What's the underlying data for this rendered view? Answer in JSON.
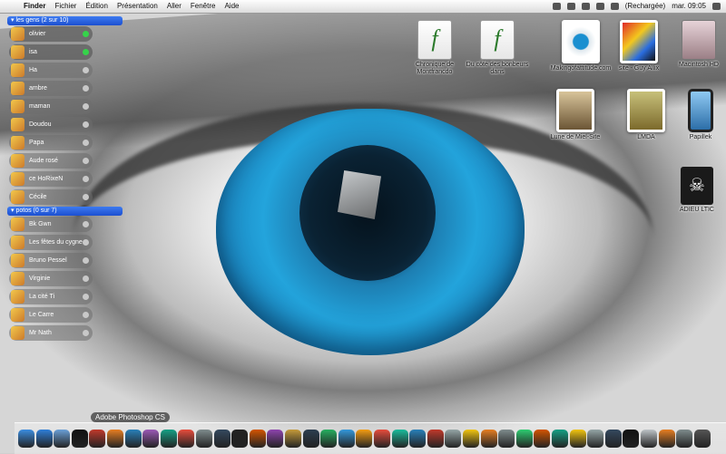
{
  "menubar": {
    "apple_glyph": "",
    "menus": [
      "Finder",
      "Fichier",
      "Édition",
      "Présentation",
      "Aller",
      "Fenêtre",
      "Aide"
    ],
    "battery_status": "(Rechargée)",
    "clock": "mar. 09:05"
  },
  "buddies": {
    "group1": {
      "title": "▾ les gens (2 sur 10)",
      "contacts": [
        {
          "name": "olivier",
          "online": true
        },
        {
          "name": "isa",
          "online": true
        },
        {
          "name": "Ha",
          "online": false
        },
        {
          "name": "ambre",
          "online": false
        },
        {
          "name": "maman",
          "online": false
        },
        {
          "name": "Doudou",
          "online": false
        },
        {
          "name": "Papa",
          "online": false
        },
        {
          "name": "Aude rosé",
          "online": false
        },
        {
          "name": "ce HoRixeN",
          "online": false
        },
        {
          "name": "Cécile",
          "online": false
        }
      ]
    },
    "group2": {
      "title": "▾ potos (0 sur 7)",
      "contacts": [
        {
          "name": "Bk Gwn",
          "online": false
        },
        {
          "name": "Les fêtes du cygne",
          "online": false
        },
        {
          "name": "Bruno Pessel",
          "online": false
        },
        {
          "name": "Virginie",
          "online": false
        },
        {
          "name": "La cité Ti",
          "online": false
        },
        {
          "name": "Le Carre",
          "online": false
        },
        {
          "name": "Mr Nath",
          "online": false
        }
      ]
    }
  },
  "desktop": {
    "icons": [
      {
        "label": "Chronique de Montfrancdo"
      },
      {
        "label": "Du côté des bonbeurs dans"
      },
      {
        "label": "Makingofattitude.com"
      },
      {
        "label": "site - Guy Allix"
      },
      {
        "label": "Macintosh HD"
      },
      {
        "label": "Lune de Miel-Site"
      },
      {
        "label": "LMDA"
      },
      {
        "label": "Papillek"
      },
      {
        "label": "ADIEU LTIC"
      }
    ]
  },
  "dock": {
    "tooltip": "Adobe Photoshop CS"
  }
}
